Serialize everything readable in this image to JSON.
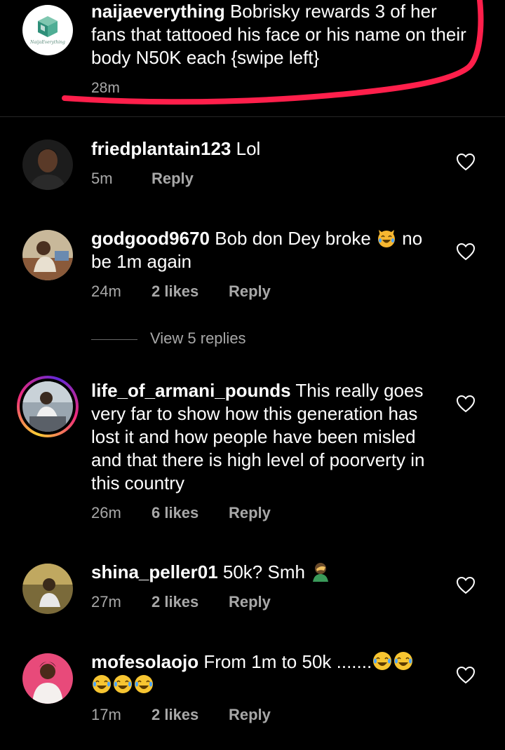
{
  "caption": {
    "username": "naijaeverything",
    "text": " Bobrisky rewards 3 of her fans that tattooed his face or his name on their body N50K each {swipe left}",
    "time": "28m",
    "logo_text": "NaijaEverything",
    "highlight_color": "#ff1f4b"
  },
  "comments": [
    {
      "username": "friedplantain123",
      "text": " Lol",
      "time": "5m",
      "likes": "",
      "reply": "Reply"
    },
    {
      "username": "godgood9670",
      "text": " Bob don Dey broke ",
      "text2": " no be 1m again",
      "emoji": [
        "cat-laughing-emoji"
      ],
      "time": "24m",
      "likes": "2 likes",
      "reply": "Reply",
      "view_replies": "View 5 replies"
    },
    {
      "username": "life_of_armani_pounds",
      "text": " This really goes very far to show how this generation has lost it and how people have been misled and that there is high level of poorverty in this country",
      "time": "26m",
      "likes": "6 likes",
      "reply": "Reply"
    },
    {
      "username": "shina_peller01",
      "text": " 50k? Smh ",
      "emoji": [
        "facepalm-emoji"
      ],
      "time": "27m",
      "likes": "2 likes",
      "reply": "Reply"
    },
    {
      "username": "mofesolaojo",
      "text": " From 1m to 50k .......",
      "emoji": [
        "joy-emoji",
        "joy-emoji",
        "joy-emoji",
        "joy-emoji",
        "joy-emoji"
      ],
      "time": "17m",
      "likes": "2 likes",
      "reply": "Reply"
    }
  ],
  "colors": {
    "background": "#000000",
    "secondary_text": "#a8a8a8",
    "divider": "#262626"
  },
  "icons": [
    "heart-outline-icon"
  ]
}
